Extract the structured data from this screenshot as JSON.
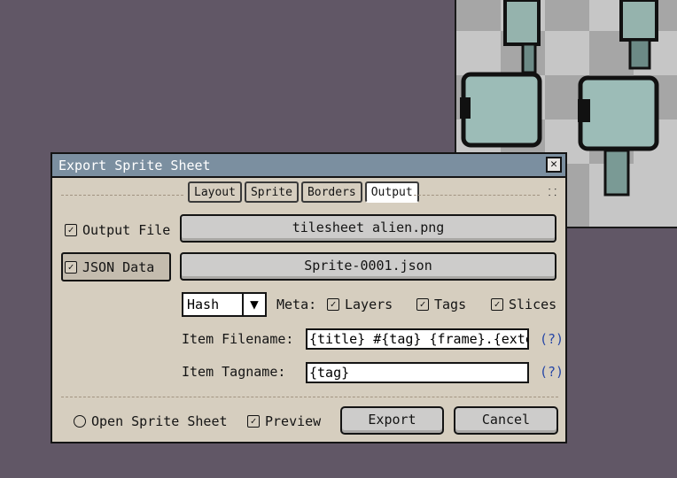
{
  "dialog": {
    "title": "Export Sprite Sheet",
    "tabs": [
      {
        "label": "Layout"
      },
      {
        "label": "Sprite"
      },
      {
        "label": "Borders"
      },
      {
        "label": "Output",
        "active": true
      }
    ],
    "output_file": {
      "label": "Output File",
      "checked": true,
      "value": "tilesheet alien.png"
    },
    "json_data": {
      "label": "JSON Data",
      "checked": true,
      "value": "Sprite-0001.json"
    },
    "format": {
      "selected": "Hash"
    },
    "meta": {
      "label": "Meta:",
      "layers": "Layers",
      "tags": "Tags",
      "slices": "Slices"
    },
    "item_filename": {
      "label": "Item Filename:",
      "value": "{title} #{tag} {frame}.{extens",
      "help": "(?)"
    },
    "item_tagname": {
      "label": "Item Tagname:",
      "value": "{tag}",
      "help": "(?)"
    },
    "open_sprite_sheet": {
      "label": "Open Sprite Sheet",
      "checked": false
    },
    "preview": {
      "label": "Preview",
      "checked": true
    },
    "buttons": {
      "export": "Export",
      "cancel": "Cancel"
    }
  },
  "colors": {
    "desktop": "#615766",
    "dialog_bg": "#d6cebf",
    "titlebar": "#7b8fa0",
    "help_link": "#2747a6"
  }
}
